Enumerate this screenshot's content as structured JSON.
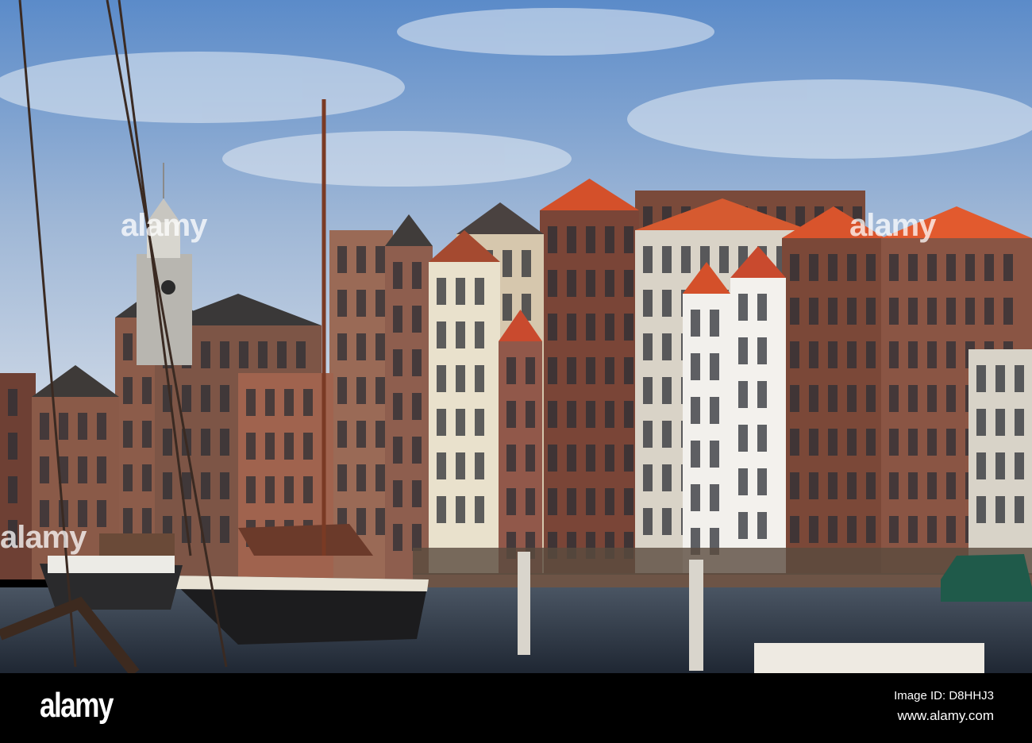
{
  "photo": {
    "subject": "harbour-canal-with-gabled-houses-and-moored-barges"
  },
  "watermark": {
    "brand": "alamy"
  },
  "footer": {
    "logo": "alamy",
    "image_id": "Image ID: D8HHJ3",
    "url": "www.alamy.com"
  },
  "colors": {
    "sky_top": "#5d8cc8",
    "sky_bottom": "#c9d6e6",
    "roof_tile": "#d9542c",
    "brick": "#7a4a3a",
    "water": "#2b3442",
    "footer_bg": "#000000"
  }
}
